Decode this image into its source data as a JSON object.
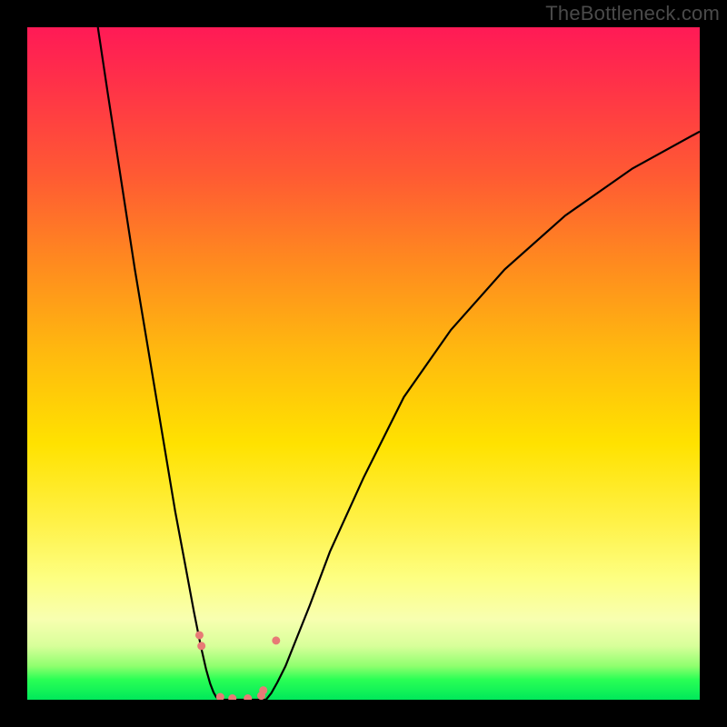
{
  "watermark": "TheBottleneck.com",
  "colors": {
    "background": "#000000",
    "curve": "#000000",
    "marker_fill": "#e77a76",
    "marker_stroke": "#e77a76",
    "gradient_stops": [
      "#ff1a56",
      "#ff3049",
      "#ff5a33",
      "#ff8a1f",
      "#ffb80f",
      "#ffe200",
      "#fff24a",
      "#fdff82",
      "#f8ffb0",
      "#d8ff9a",
      "#8fff6e",
      "#2aff55",
      "#00e85a"
    ]
  },
  "chart_data": {
    "type": "line",
    "title": "",
    "xlabel": "",
    "ylabel": "",
    "x_range": [
      0,
      100
    ],
    "y_range": [
      0,
      100
    ],
    "grid": false,
    "legend": false,
    "series": [
      {
        "name": "left-branch",
        "x": [
          10.5,
          12,
          14,
          16,
          18,
          20,
          22,
          23.5,
          24.8,
          25.8,
          26.6,
          27.2,
          27.7,
          28.1,
          28.5
        ],
        "y": [
          100,
          90,
          77,
          64,
          52,
          40,
          28,
          20,
          13,
          8,
          4.5,
          2.4,
          1.1,
          0.4,
          0.0
        ]
      },
      {
        "name": "floor",
        "x": [
          28.5,
          30,
          32,
          34,
          35.5
        ],
        "y": [
          0.0,
          0.0,
          0.0,
          0.0,
          0.0
        ]
      },
      {
        "name": "right-branch",
        "x": [
          35.5,
          36.3,
          37.2,
          38.4,
          40,
          42,
          45,
          50,
          56,
          63,
          71,
          80,
          90,
          100
        ],
        "y": [
          0.0,
          1.0,
          2.6,
          5.0,
          9,
          14,
          22,
          33,
          45,
          55,
          64,
          72,
          79,
          84.5
        ]
      }
    ],
    "markers": {
      "name": "highlight-points",
      "x": [
        25.6,
        25.9,
        28.7,
        30.5,
        32.8,
        34.8,
        35.1,
        37.0
      ],
      "y": [
        9.6,
        8.0,
        0.4,
        0.2,
        0.2,
        0.6,
        1.4,
        8.8
      ],
      "size": 8
    }
  }
}
